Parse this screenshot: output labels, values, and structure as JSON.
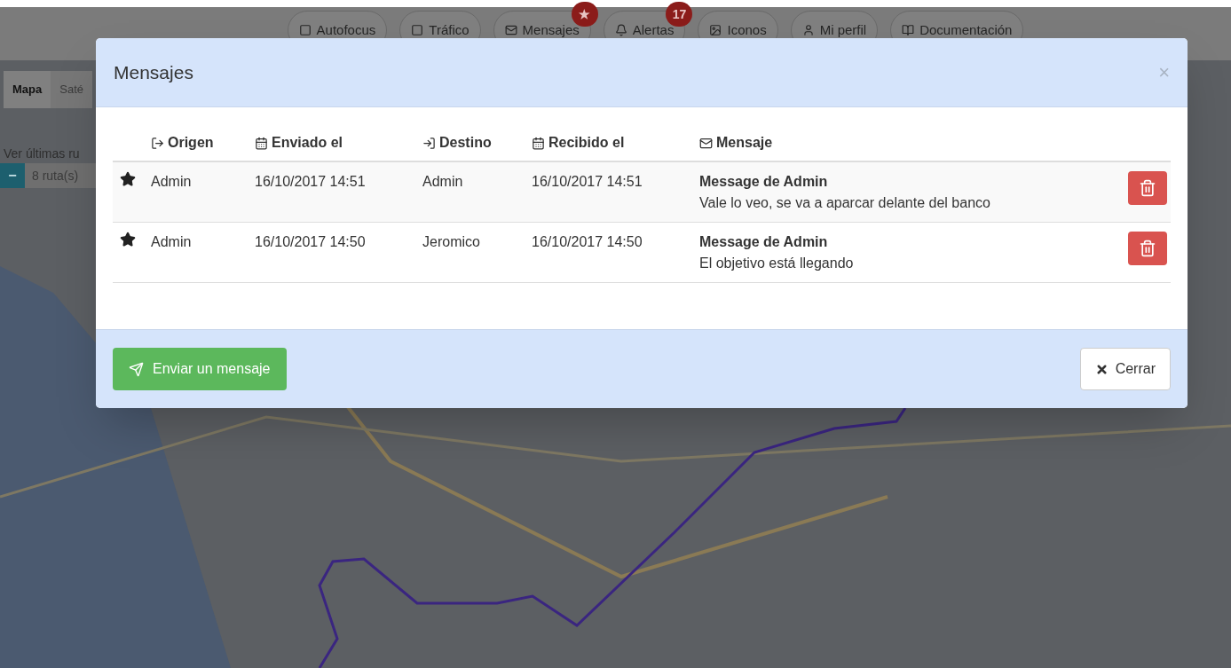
{
  "nav": [
    {
      "label": "Autofocus"
    },
    {
      "label": "Tráfico"
    },
    {
      "label": "Mensajes",
      "badge": "★"
    },
    {
      "label": "Alertas",
      "badge": "17"
    },
    {
      "label": "Iconos"
    },
    {
      "label": "Mi perfil"
    },
    {
      "label": "Documentación"
    }
  ],
  "map_tabs": [
    {
      "label": "Mapa",
      "selected": true
    },
    {
      "label": "Saté",
      "selected": false
    }
  ],
  "routes": {
    "label": "Ver últimas ru",
    "button": "−",
    "value": "8 ruta(s)"
  },
  "modal": {
    "title": "Mensajes",
    "close": "×",
    "columns": [
      {
        "label": "Origen"
      },
      {
        "label": "Enviado el"
      },
      {
        "label": "Destino"
      },
      {
        "label": "Recibido el"
      },
      {
        "label": "Mensaje"
      }
    ],
    "rows": [
      {
        "origin": "Admin",
        "sent": "16/10/2017 14:51",
        "destination": "Admin",
        "received": "16/10/2017 14:51",
        "subject": "Message de Admin",
        "body": "Vale lo veo, se va a aparcar delante del banco"
      },
      {
        "origin": "Admin",
        "sent": "16/10/2017 14:50",
        "destination": "Jeromico",
        "received": "16/10/2017 14:50",
        "subject": "Message de Admin",
        "body": "El objetivo está llegando"
      }
    ],
    "send_button": "Enviar un mensaje",
    "close_button": "Cerrar"
  }
}
